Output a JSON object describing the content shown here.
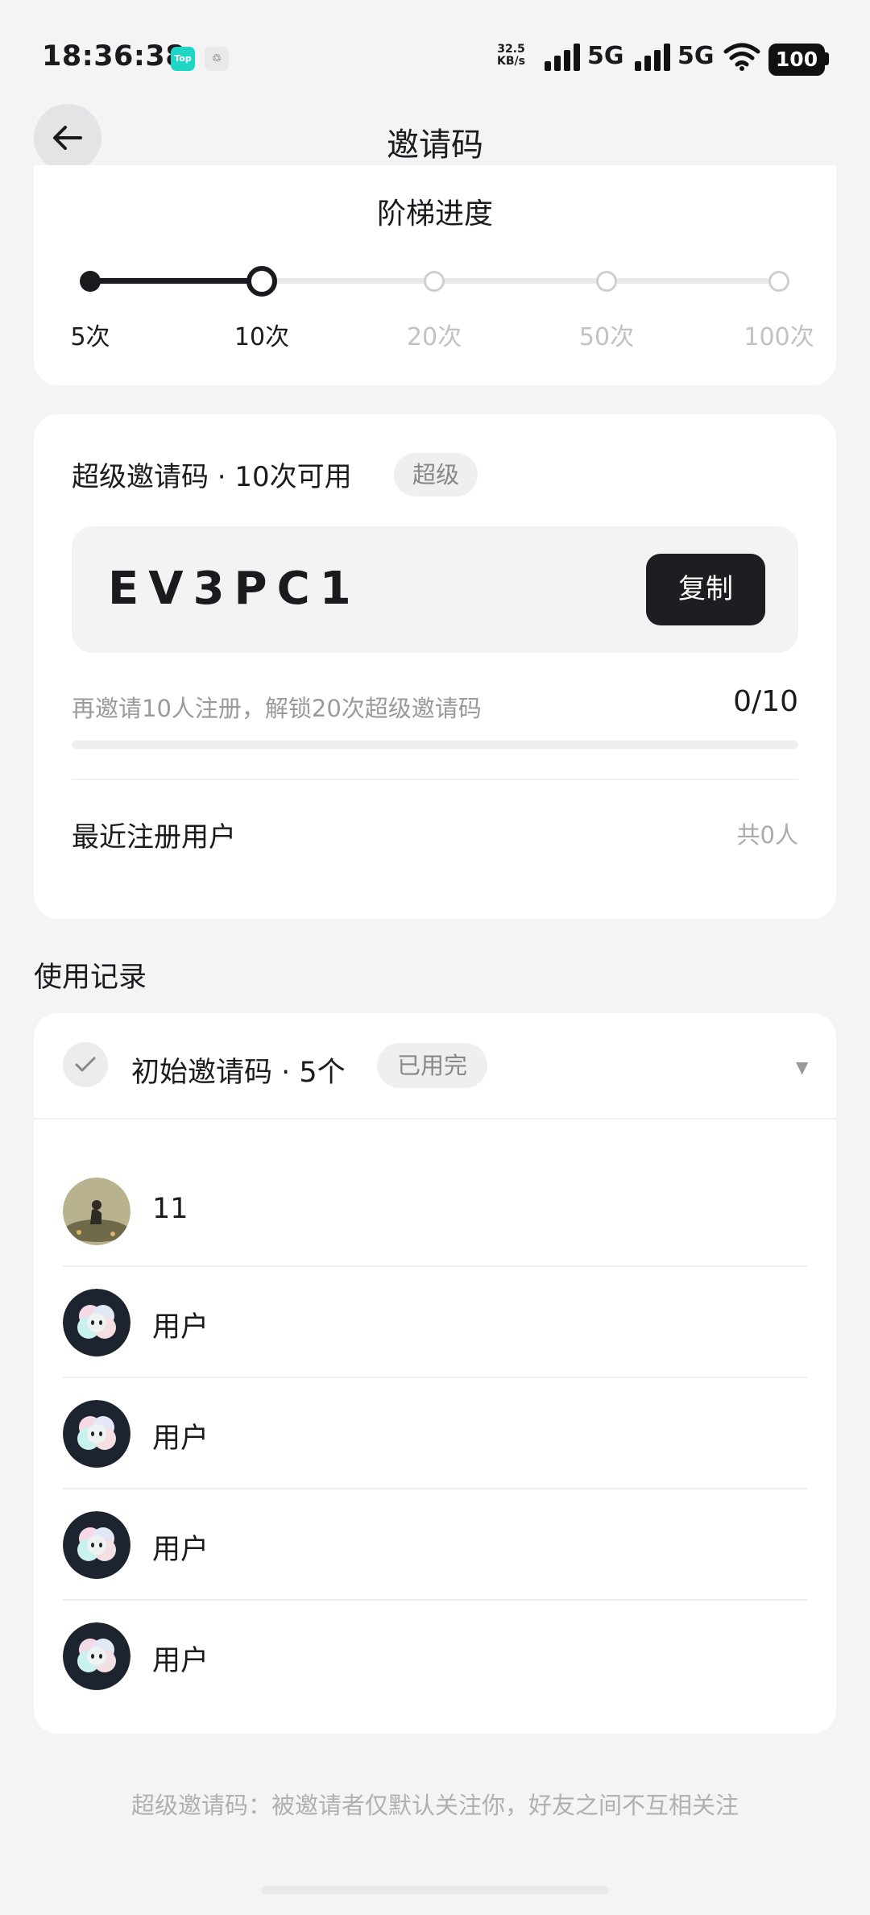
{
  "status_bar": {
    "time": "18:36:38",
    "app1": "Top",
    "app2": "♲",
    "speed_value": "32.5",
    "speed_unit": "KB/s",
    "net1": "5G",
    "net2": "5G",
    "battery": "100"
  },
  "header": {
    "title": "邀请码"
  },
  "ladder": {
    "title": "阶梯进度",
    "steps": [
      "5次",
      "10次",
      "20次",
      "50次",
      "100次"
    ],
    "current_step_index": 1,
    "accent_color": "#1b1b1f"
  },
  "super_code": {
    "heading": "超级邀请码 · 10次可用",
    "tag": "超级",
    "code": "EV3PC1",
    "copy_label": "复制",
    "hint": "再邀请10人注册，解锁20次超级邀请码",
    "progress_text": "0/10",
    "progress_fraction": 0,
    "recent_label": "最近注册用户",
    "recent_count": "共0人"
  },
  "records": {
    "section_title": "使用记录",
    "group_label": "初始邀请码 · 5个",
    "group_tag": "已用完",
    "items": [
      {
        "name": "11",
        "avatar": "photo-avatar"
      },
      {
        "name": "用户",
        "avatar": "bot-avatar"
      },
      {
        "name": "用户",
        "avatar": "bot-avatar"
      },
      {
        "name": "用户",
        "avatar": "bot-avatar"
      },
      {
        "name": "用户",
        "avatar": "bot-avatar"
      }
    ]
  },
  "footer": {
    "note": "超级邀请码：被邀请者仅默认关注你，好友之间不互相关注"
  }
}
